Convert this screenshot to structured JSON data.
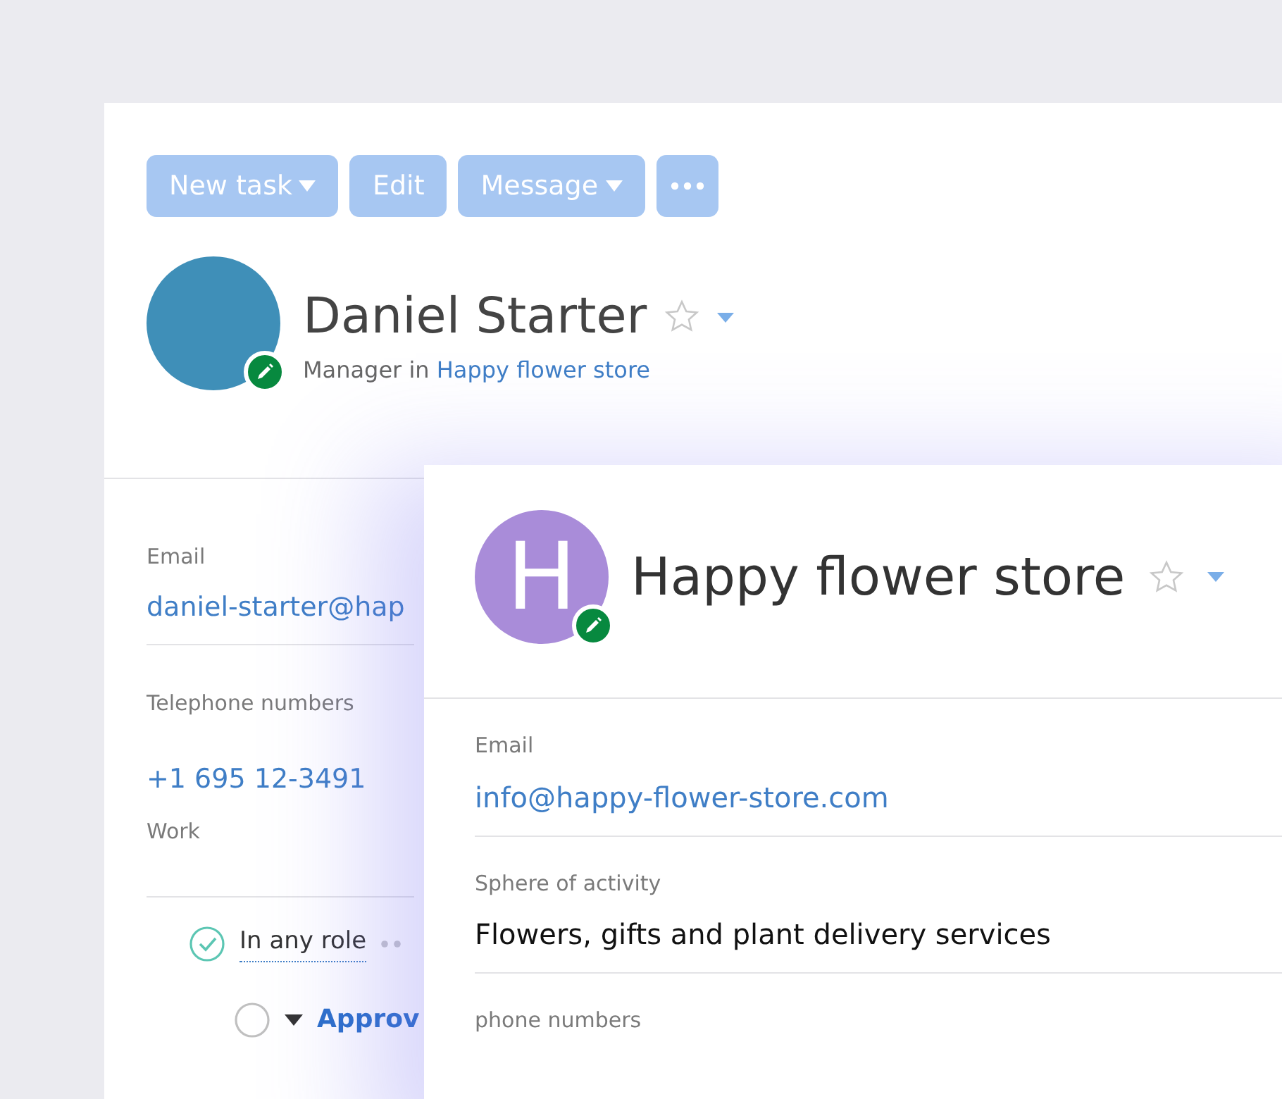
{
  "toolbar": {
    "buttons": [
      {
        "kind": "text",
        "label": "New task",
        "dropdown": true
      },
      {
        "kind": "text",
        "label": "Edit",
        "dropdown": false
      },
      {
        "kind": "text",
        "label": "Message",
        "dropdown": true
      },
      {
        "kind": "more"
      }
    ]
  },
  "contact": {
    "name": "Daniel Starter",
    "favorite": false,
    "position": "Manager in",
    "company_link": "Happy flower store",
    "fields": [
      {
        "kind": "link",
        "label": "Email",
        "value": "daniel-starter@hap"
      },
      {
        "kind": "phone",
        "label": "Telephone numbers",
        "value": "+1 695 12-3491",
        "note": "Work"
      }
    ],
    "roles": [
      {
        "kind": "role",
        "label": "In any role",
        "checked": true
      },
      {
        "kind": "stage",
        "label": "Approv",
        "checked": false
      }
    ]
  },
  "company_panel": {
    "avatar_letter": "H",
    "name": "Happy flower store",
    "favorite": false,
    "fields": [
      {
        "kind": "link",
        "label": "Email",
        "value": "info@happy-flower-store.com"
      },
      {
        "kind": "text",
        "label": "Sphere of activity",
        "value": "Flowers, gifts and plant delivery services"
      },
      {
        "kind": "label",
        "label": "phone numbers"
      }
    ]
  }
}
